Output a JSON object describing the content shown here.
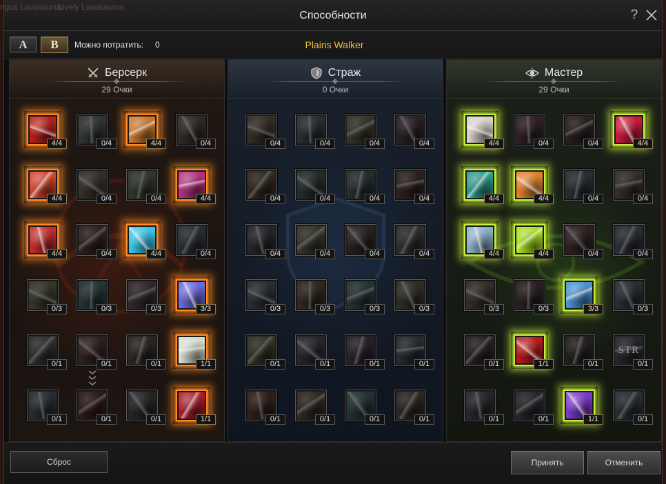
{
  "window": {
    "title": "Способности",
    "help_label": "?",
    "help_icon": "question-icon",
    "close_icon": "close-icon",
    "background_labels": [
      "ngus Lavasaurus",
      "Lively Lavasaurus"
    ]
  },
  "presets": [
    {
      "label": "A",
      "selected": false
    },
    {
      "label": "B",
      "selected": true
    }
  ],
  "spendable_points": {
    "label": "Можно потратить:",
    "value": "0"
  },
  "build_name": "Plains Walker",
  "colors": {
    "build_name": "#f2c23a"
  },
  "trees": [
    {
      "name": "Берсерк",
      "icon": "crossed-swords-icon",
      "points": "29",
      "points_label": "Очки",
      "glow": "#ff8a26",
      "connector_icon": "chevrons-down-icon",
      "skills": [
        [
          {
            "level": "4/4",
            "active": true,
            "color": "#b81e1a"
          },
          {
            "level": "0/4",
            "active": false,
            "color": "#5e6a6a"
          },
          {
            "level": "4/4",
            "active": true,
            "color": "#c8762c"
          },
          {
            "level": "0/4",
            "active": false,
            "color": "#6e4e3a"
          }
        ],
        [
          {
            "level": "4/4",
            "active": true,
            "color": "#d2402a"
          },
          {
            "level": "0/4",
            "active": false,
            "color": "#7a5a40"
          },
          {
            "level": "0/4",
            "active": false,
            "color": "#5a6e4a"
          },
          {
            "level": "4/4",
            "active": true,
            "color": "#b4307e"
          }
        ],
        [
          {
            "level": "4/4",
            "active": true,
            "color": "#c42a2a"
          },
          {
            "level": "0/4",
            "active": false,
            "color": "#6e3a30"
          },
          {
            "level": "4/4",
            "active": true,
            "color": "#36c4e6"
          },
          {
            "level": "0/4",
            "active": false,
            "color": "#4a5a72"
          }
        ],
        [
          {
            "level": "0/3",
            "active": false,
            "color": "#6e6a3a"
          },
          {
            "level": "0/3",
            "active": false,
            "color": "#3a6a6e"
          },
          {
            "level": "0/3",
            "active": false,
            "color": "#6a4a5e"
          },
          {
            "level": "3/3",
            "active": true,
            "color": "#6a68da"
          }
        ],
        [
          {
            "level": "0/1",
            "active": false,
            "color": "#5a5a5a"
          },
          {
            "level": "0/1",
            "active": false,
            "color": "#6e3a3a"
          },
          {
            "level": "0/1",
            "active": false,
            "color": "#5a4a3a"
          },
          {
            "level": "1/1",
            "active": true,
            "color": "#d6dccc"
          }
        ],
        [
          {
            "level": "0/1",
            "active": false,
            "color": "#4a5a6e"
          },
          {
            "level": "0/1",
            "active": false,
            "color": "#6e2a2a"
          },
          {
            "level": "0/1",
            "active": false,
            "color": "#4e4a4a"
          },
          {
            "level": "1/1",
            "active": true,
            "color": "#a81c2a"
          }
        ]
      ]
    },
    {
      "name": "Страж",
      "icon": "shield-icon",
      "points": "0",
      "points_label": "Очки",
      "glow": "#6ea2e0",
      "skills": [
        [
          {
            "level": "0/4",
            "active": false,
            "color": "#6e5a3a"
          },
          {
            "level": "0/4",
            "active": false,
            "color": "#4a5a6e"
          },
          {
            "level": "0/4",
            "active": false,
            "color": "#6a6a3a"
          },
          {
            "level": "0/4",
            "active": false,
            "color": "#5e3a4e"
          }
        ],
        [
          {
            "level": "0/4",
            "active": false,
            "color": "#6e4a2a"
          },
          {
            "level": "0/4",
            "active": false,
            "color": "#3a5a5a"
          },
          {
            "level": "0/4",
            "active": false,
            "color": "#3a5e62"
          },
          {
            "level": "0/4",
            "active": false,
            "color": "#6a3a3a"
          }
        ],
        [
          {
            "level": "0/4",
            "active": false,
            "color": "#4a4a5e"
          },
          {
            "level": "0/4",
            "active": false,
            "color": "#6a6a3a"
          },
          {
            "level": "0/4",
            "active": false,
            "color": "#5e3a3a"
          },
          {
            "level": "0/4",
            "active": false,
            "color": "#5a5a5a"
          }
        ],
        [
          {
            "level": "0/3",
            "active": false,
            "color": "#4a5a6e"
          },
          {
            "level": "0/3",
            "active": false,
            "color": "#6e4a2a"
          },
          {
            "level": "0/3",
            "active": false,
            "color": "#3a6a6a"
          },
          {
            "level": "0/3",
            "active": false,
            "color": "#5e5a3a"
          }
        ],
        [
          {
            "level": "0/1",
            "active": false,
            "color": "#5a6a2a"
          },
          {
            "level": "0/1",
            "active": false,
            "color": "#4a4a6e"
          },
          {
            "level": "0/1",
            "active": false,
            "color": "#5a3a6a"
          },
          {
            "level": "0/1",
            "active": false,
            "color": "#3a5a6a"
          }
        ],
        [
          {
            "level": "0/1",
            "active": false,
            "color": "#6e3a2a"
          },
          {
            "level": "0/1",
            "active": false,
            "color": "#6e4a3a"
          },
          {
            "level": "0/1",
            "active": false,
            "color": "#2a6a6a"
          },
          {
            "level": "0/1",
            "active": false,
            "color": "#5a4a3a"
          }
        ]
      ]
    },
    {
      "name": "Мастер",
      "icon": "eye-icon",
      "points": "29",
      "points_label": "Очки",
      "glow": "#c6f03c",
      "skills": [
        [
          {
            "level": "4/4",
            "active": true,
            "color": "#d8d0c8"
          },
          {
            "level": "0/4",
            "active": false,
            "color": "#6e3a4a"
          },
          {
            "level": "0/4",
            "active": false,
            "color": "#5e3a3a"
          },
          {
            "level": "4/4",
            "active": true,
            "color": "#c81838"
          }
        ],
        [
          {
            "level": "4/4",
            "active": true,
            "color": "#2a9a8a"
          },
          {
            "level": "4/4",
            "active": true,
            "color": "#e0802a"
          },
          {
            "level": "0/4",
            "active": false,
            "color": "#4a5a6e"
          },
          {
            "level": "0/4",
            "active": false,
            "color": "#6a5a4a"
          }
        ],
        [
          {
            "level": "4/4",
            "active": true,
            "color": "#8ab0c8"
          },
          {
            "level": "4/4",
            "active": true,
            "color": "#a8e020"
          },
          {
            "level": "0/4",
            "active": false,
            "color": "#6e3a3a"
          },
          {
            "level": "0/4",
            "active": false,
            "color": "#4a5a6e"
          }
        ],
        [
          {
            "level": "0/3",
            "active": false,
            "color": "#6e5a3a"
          },
          {
            "level": "0/3",
            "active": false,
            "color": "#5e3a3a"
          },
          {
            "level": "3/3",
            "active": true,
            "color": "#4a90d0"
          },
          {
            "level": "0/3",
            "active": false,
            "color": "#4a5a6e"
          }
        ],
        [
          {
            "level": "0/1",
            "active": false,
            "color": "#5e3a3a"
          },
          {
            "level": "1/1",
            "active": true,
            "color": "#b81818"
          },
          {
            "level": "0/1",
            "active": false,
            "color": "#4e3a3a"
          },
          {
            "level": "0/1",
            "active": false,
            "color": "#4a4a56",
            "icon_text": "STR"
          }
        ],
        [
          {
            "level": "0/1",
            "active": false,
            "color": "#4a4a5e"
          },
          {
            "level": "0/1",
            "active": false,
            "color": "#4a4a5e"
          },
          {
            "level": "1/1",
            "active": true,
            "color": "#7a38c8"
          },
          {
            "level": "0/1",
            "active": false,
            "color": "#4a5a6e"
          }
        ]
      ]
    }
  ],
  "footer": {
    "reset_label": "Сброс",
    "accept_label": "Принять",
    "cancel_label": "Отменить"
  }
}
